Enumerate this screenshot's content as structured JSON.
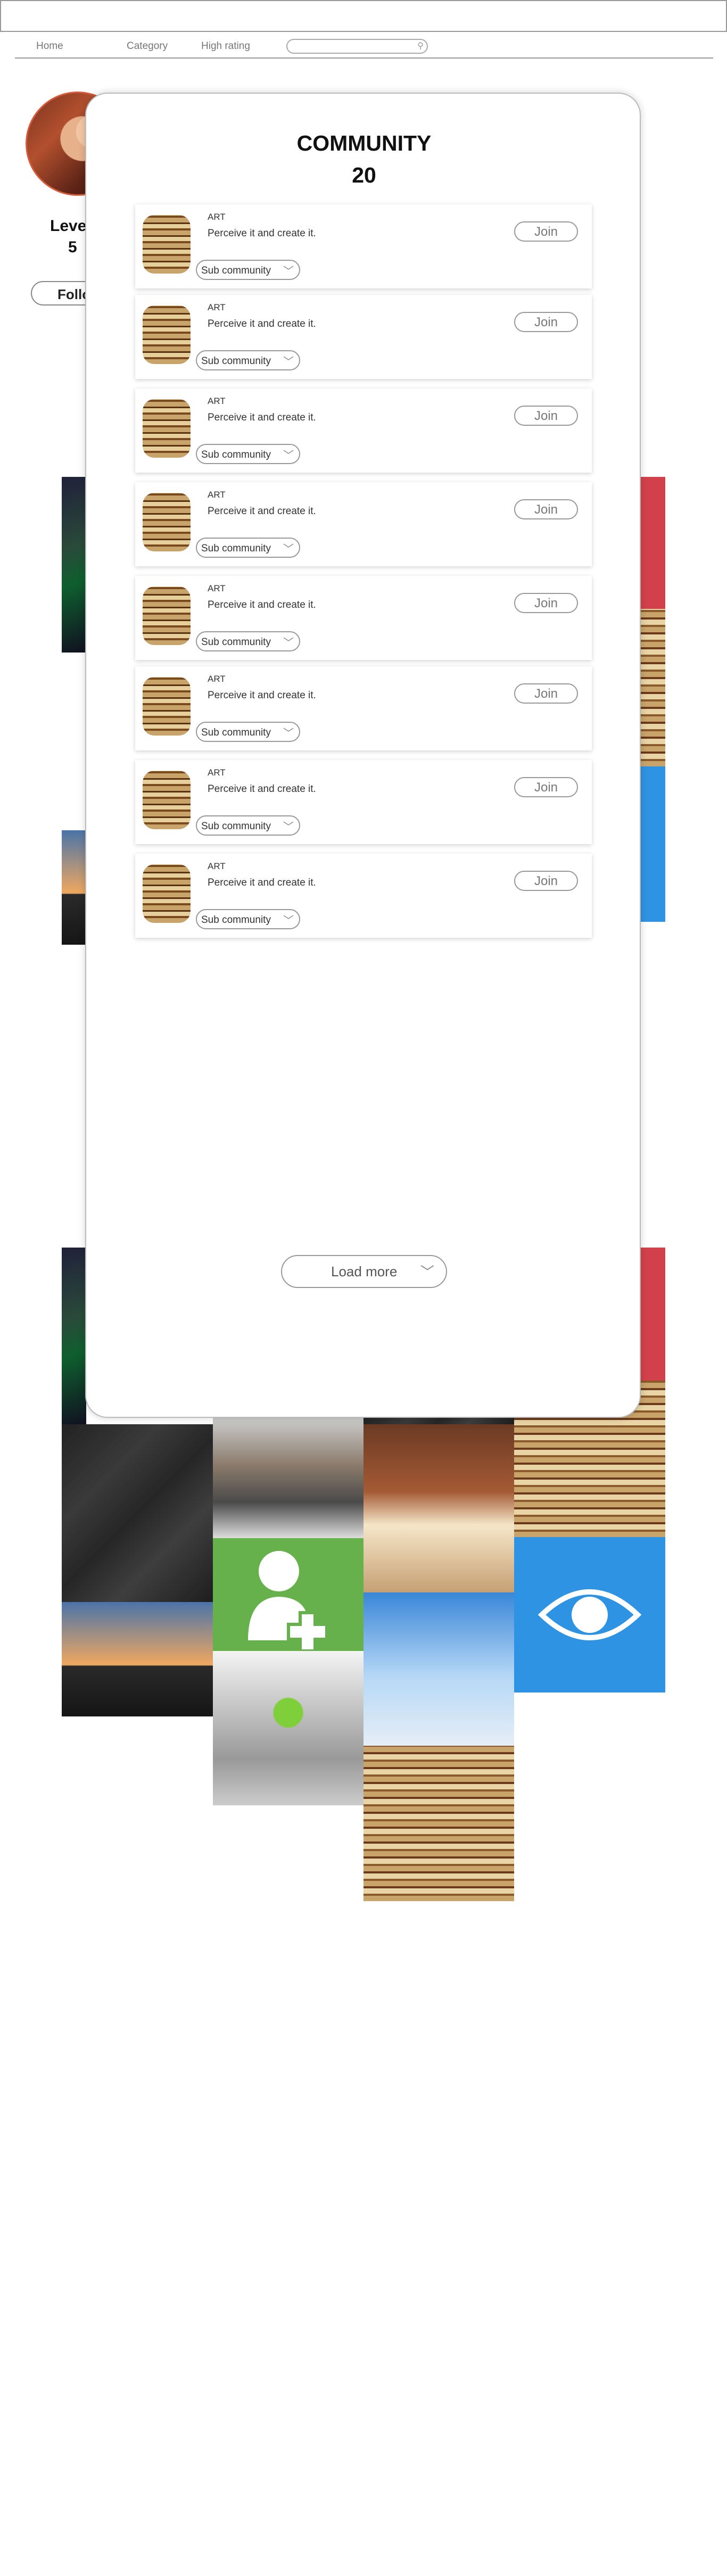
{
  "nav": {
    "home": "Home",
    "category": "Category",
    "high_rating": "High rating",
    "search_placeholder": ""
  },
  "profile": {
    "level_label": "Leve",
    "level_value": "5",
    "follow_label": "Follo"
  },
  "modal": {
    "title": "COMMUNITY",
    "count": "20",
    "load_more": "Load more",
    "cards": [
      {
        "title": "ART",
        "desc": "Perceive it and create it.",
        "sub": "Sub community",
        "join": "Join"
      },
      {
        "title": "ART",
        "desc": "Perceive it and create it.",
        "sub": "Sub community",
        "join": "Join"
      },
      {
        "title": "ART",
        "desc": "Perceive it and create it.",
        "sub": "Sub community",
        "join": "Join"
      },
      {
        "title": "ART",
        "desc": "Perceive it and create it.",
        "sub": "Sub community",
        "join": "Join"
      },
      {
        "title": "ART",
        "desc": "Perceive it and create it.",
        "sub": "Sub community",
        "join": "Join"
      },
      {
        "title": "ART",
        "desc": "Perceive it and create it.",
        "sub": "Sub community",
        "join": "Join"
      },
      {
        "title": "ART",
        "desc": "Perceive it and create it.",
        "sub": "Sub community",
        "join": "Join"
      },
      {
        "title": "ART",
        "desc": "Perceive it and create it.",
        "sub": "Sub community",
        "join": "Join"
      }
    ]
  },
  "colors": {
    "tile_red": "#d2414b",
    "tile_blue": "#2f93e3",
    "tile_green": "#66b14b"
  },
  "icons": {
    "add_user": "add-user-icon",
    "eye": "eye-icon",
    "search": "search-icon",
    "chevron": "chevron-down-icon"
  }
}
